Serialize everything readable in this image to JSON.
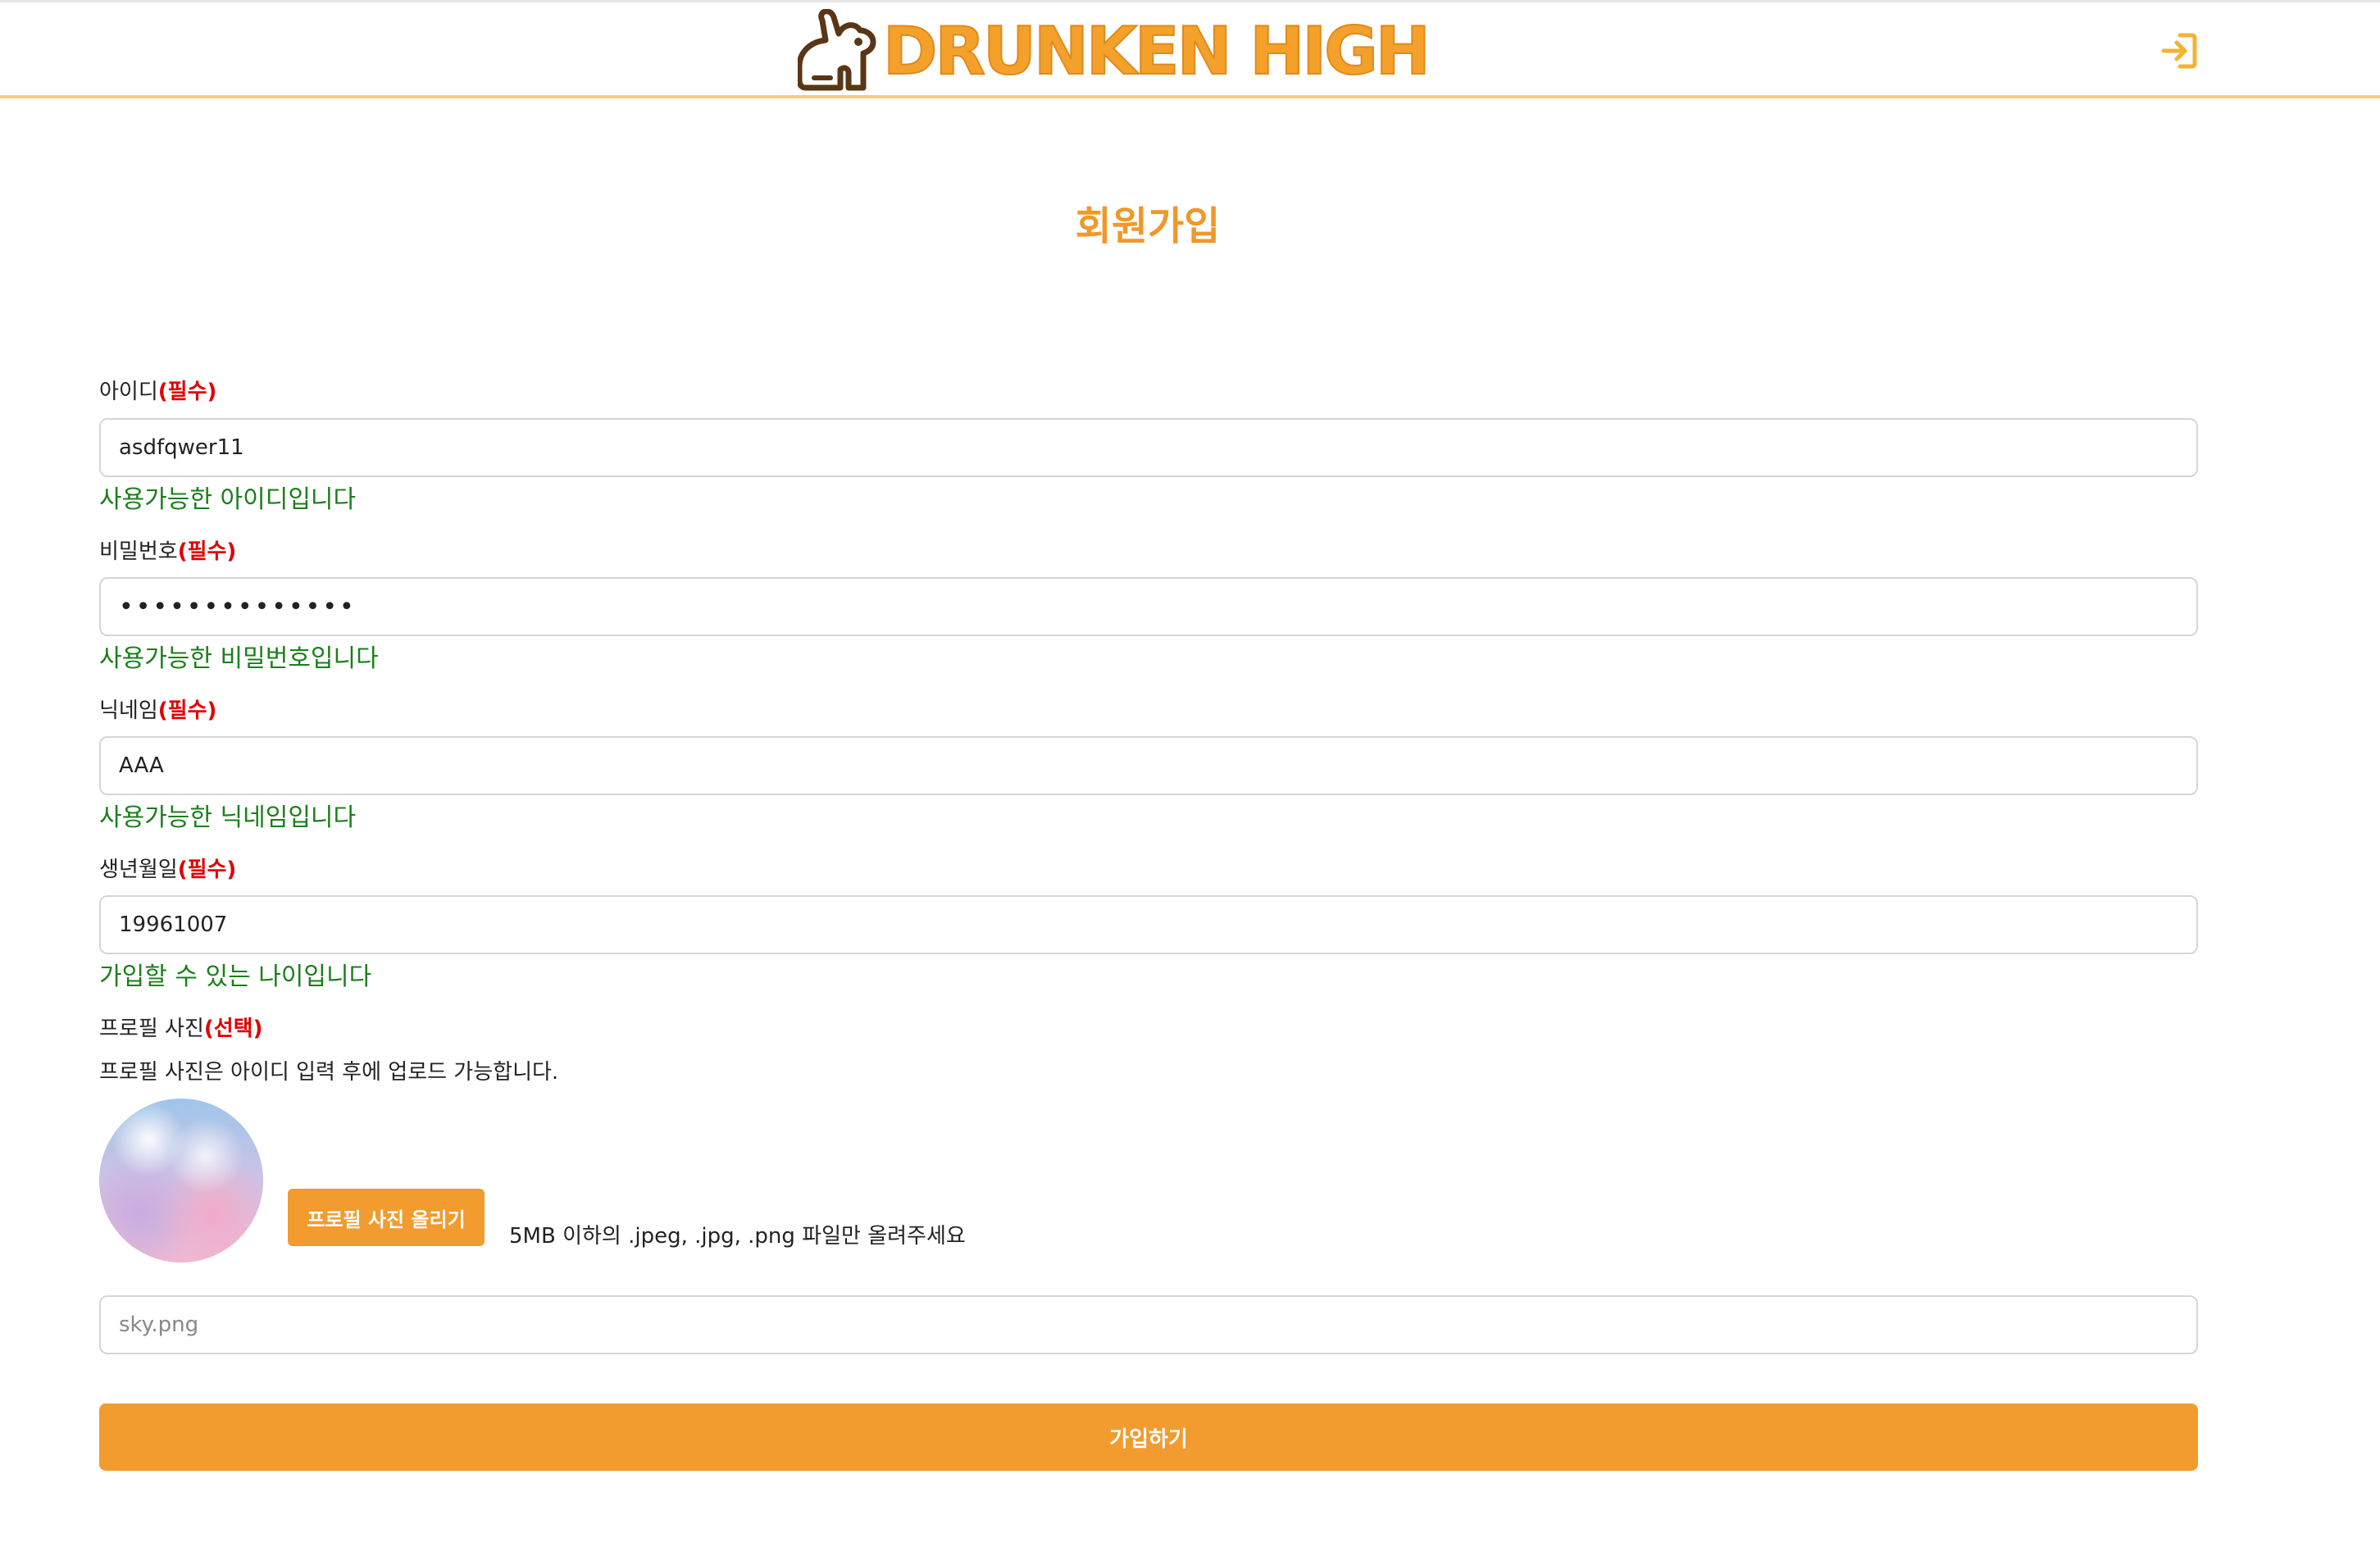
{
  "header": {
    "logo_text": "DRUNKEN HIGH",
    "logo_icon": "rabbit-logo-icon",
    "login_icon": "login-arrow-icon",
    "accent_color": "#f29b2f"
  },
  "page": {
    "title": "회원가입"
  },
  "form": {
    "id": {
      "label": "아이디",
      "required": "(필수)",
      "value": "asdfqwer11",
      "message": "사용가능한 아이디입니다"
    },
    "password": {
      "label": "비밀번호",
      "required": "(필수)",
      "value": "••••••••••••••",
      "message": "사용가능한 비밀번호입니다"
    },
    "nickname": {
      "label": "닉네임",
      "required": "(필수)",
      "value": "AAA",
      "message": "사용가능한 닉네임입니다"
    },
    "birth": {
      "label": "생년월일",
      "required": "(필수)",
      "value": "19961007",
      "message": "가입할 수 있는 나이입니다"
    },
    "profile": {
      "label": "프로필 사진",
      "optional": "(선택)",
      "hint": "프로필 사진은 아이디 입력 후에 업로드 가능합니다.",
      "upload_label": "프로필 사진 올리기",
      "upload_note": "5MB 이하의 .jpeg, .jpg, .png 파일만 올려주세요",
      "file_placeholder": "sky.png"
    },
    "submit_label": "가입하기",
    "success_color": "#1a7f1a",
    "required_color": "#e00000"
  }
}
